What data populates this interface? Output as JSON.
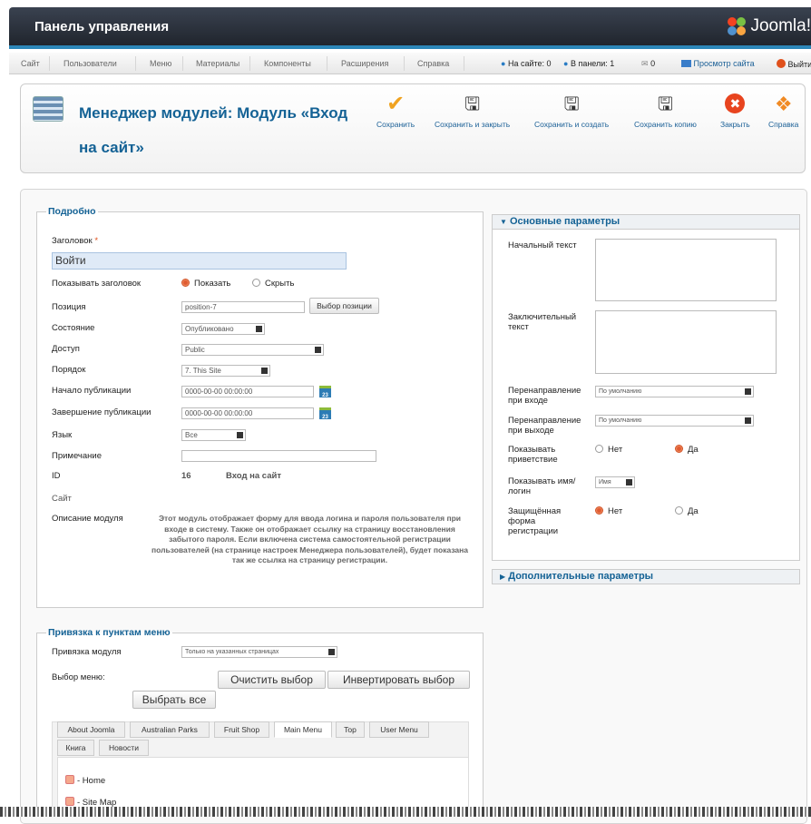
{
  "header": {
    "title": "Панель управления",
    "logo_text": "Joomla!"
  },
  "menu": {
    "items": [
      "Сайт",
      "Пользователи",
      "Меню",
      "Материалы",
      "Компоненты",
      "Расширения",
      "Справка"
    ],
    "status": {
      "online": "На сайте: 0",
      "in_panel": "В панели: 1",
      "messages": "0",
      "view_site": "Просмотр сайта",
      "logout": "Выйти"
    }
  },
  "toolbar": {
    "title": "Менеджер модулей: Модуль «Вход на сайт»",
    "buttons": [
      {
        "label": "Сохранить",
        "icon": "checkmark-icon"
      },
      {
        "label": "Сохранить и закрыть",
        "icon": "save-close-icon"
      },
      {
        "label": "Сохранить и создать",
        "icon": "save-new-icon"
      },
      {
        "label": "Сохранить копию",
        "icon": "save-copy-icon"
      },
      {
        "label": "Закрыть",
        "icon": "close-icon"
      },
      {
        "label": "Справка",
        "icon": "help-icon"
      }
    ]
  },
  "details": {
    "legend": "Подробно",
    "title_label": "Заголовок",
    "required_mark": "*",
    "title_value": "Войти",
    "show_title_label": "Показывать заголовок",
    "show_option": "Показать",
    "hide_option": "Скрыть",
    "position_label": "Позиция",
    "position_value": "position-7",
    "position_button": "Выбор позиции",
    "state_label": "Состояние",
    "state_value": "Опубликовано",
    "access_label": "Доступ",
    "access_value": "Public",
    "order_label": "Порядок",
    "order_value": "7. This Site",
    "publish_up_label": "Начало публикации",
    "publish_up_value": "0000-00-00 00:00:00",
    "publish_down_label": "Завершение публикации",
    "publish_down_value": "0000-00-00 00:00:00",
    "calendar_day": "23",
    "lang_label": "Язык",
    "lang_value": "Все",
    "note_label": "Примечание",
    "note_value": "",
    "id_label": "ID",
    "id_value": "16",
    "id_name": "Вход на сайт",
    "site_label": "Сайт",
    "desc_label": "Описание модуля",
    "desc_text": "Этот модуль отображает форму для ввода логина и пароля пользователя при входе в систему. Также он отображает ссылку на страницу восстановления забытого пароля. Если включена система самостоятельной регистрации пользователей (на странице настроек Менеджера пользователей), будет показана так же ссылка на страницу регистрации."
  },
  "params": {
    "basic_header": "Основные параметры",
    "pretext_label": "Начальный текст",
    "posttext_label": "Заключительный текст",
    "login_redirect_label": "Перенаправление при входе",
    "login_redirect_value": "По умолчанию",
    "logout_redirect_label": "Перенаправление при выходе",
    "logout_redirect_value": "По умолчанию",
    "greeting_label": "Показывать приветствие",
    "no": "Нет",
    "yes": "Да",
    "name_label": "Показывать имя/логин",
    "name_value": "Имя",
    "secure_label": "Защищённая форма регистрации",
    "advanced_header": "Дополнительные параметры"
  },
  "assignment": {
    "legend": "Привязка к пунктам меню",
    "module_label": "Привязка модуля",
    "module_value": "Только на указанных страницах",
    "menu_select_label": "Выбор меню:",
    "clear_button": "Очистить выбор",
    "invert_button": "Инвертировать выбор",
    "select_all_button": "Выбрать все",
    "tabs": [
      "About Joomla",
      "Australian Parks",
      "Fruit Shop",
      "Main Menu",
      "Top",
      "User Menu",
      "Книга",
      "Новости"
    ],
    "active_tab": "Main Menu",
    "items": [
      "- Home",
      "- Site Map"
    ]
  },
  "colors": {
    "accent": "#146295",
    "topbar": "#2a303a",
    "brand_orange": "#f08a24"
  }
}
